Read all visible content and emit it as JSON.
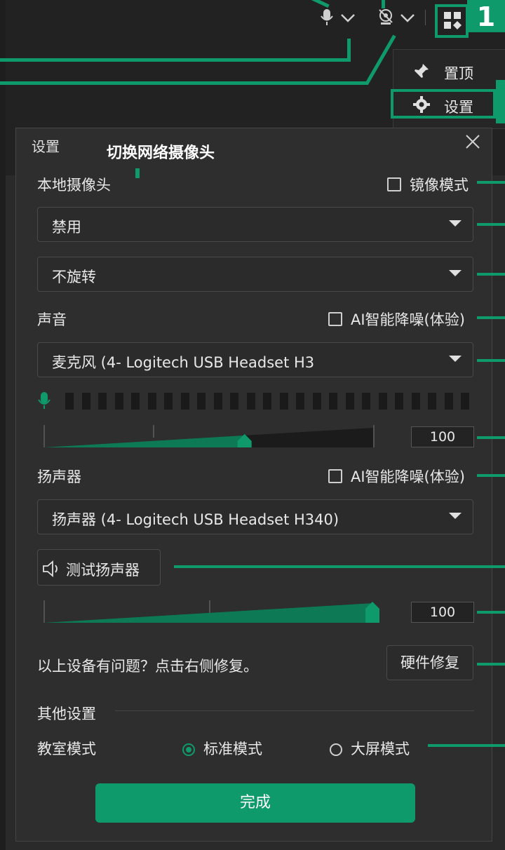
{
  "callout_number": "1",
  "menu": {
    "pin_label": "置顶",
    "settings_label": "设置"
  },
  "panel": {
    "title": "设置",
    "annotation": "切换网络摄像头"
  },
  "camera": {
    "section_label": "本地摄像头",
    "mirror_label": "镜像模式",
    "device_value": "禁用",
    "rotation_value": "不旋转"
  },
  "sound": {
    "section_label": "声音",
    "noise_label": "AI智能降噪(体验)",
    "mic_value": "麦克风 (4- Logitech USB Headset H3",
    "mic_volume": "100",
    "mic_volume_level": 0.61
  },
  "speaker": {
    "section_label": "扬声器",
    "noise_label": "AI智能降噪(体验)",
    "device_value": "扬声器 (4- Logitech USB Headset H340)",
    "test_label": "测试扬声器",
    "volume": "100",
    "volume_level": 1.0
  },
  "repair": {
    "hint": "以上设备有问题？点击右侧修复。",
    "button_label": "硬件修复"
  },
  "other": {
    "section_label": "其他设置",
    "classroom_label": "教室模式",
    "standard_label": "标准模式",
    "bigscreen_label": "大屏模式",
    "selected": "标准模式"
  },
  "done_label": "完成",
  "colors": {
    "accent": "#0e9a6a",
    "panel_bg": "#2e2e2e"
  }
}
